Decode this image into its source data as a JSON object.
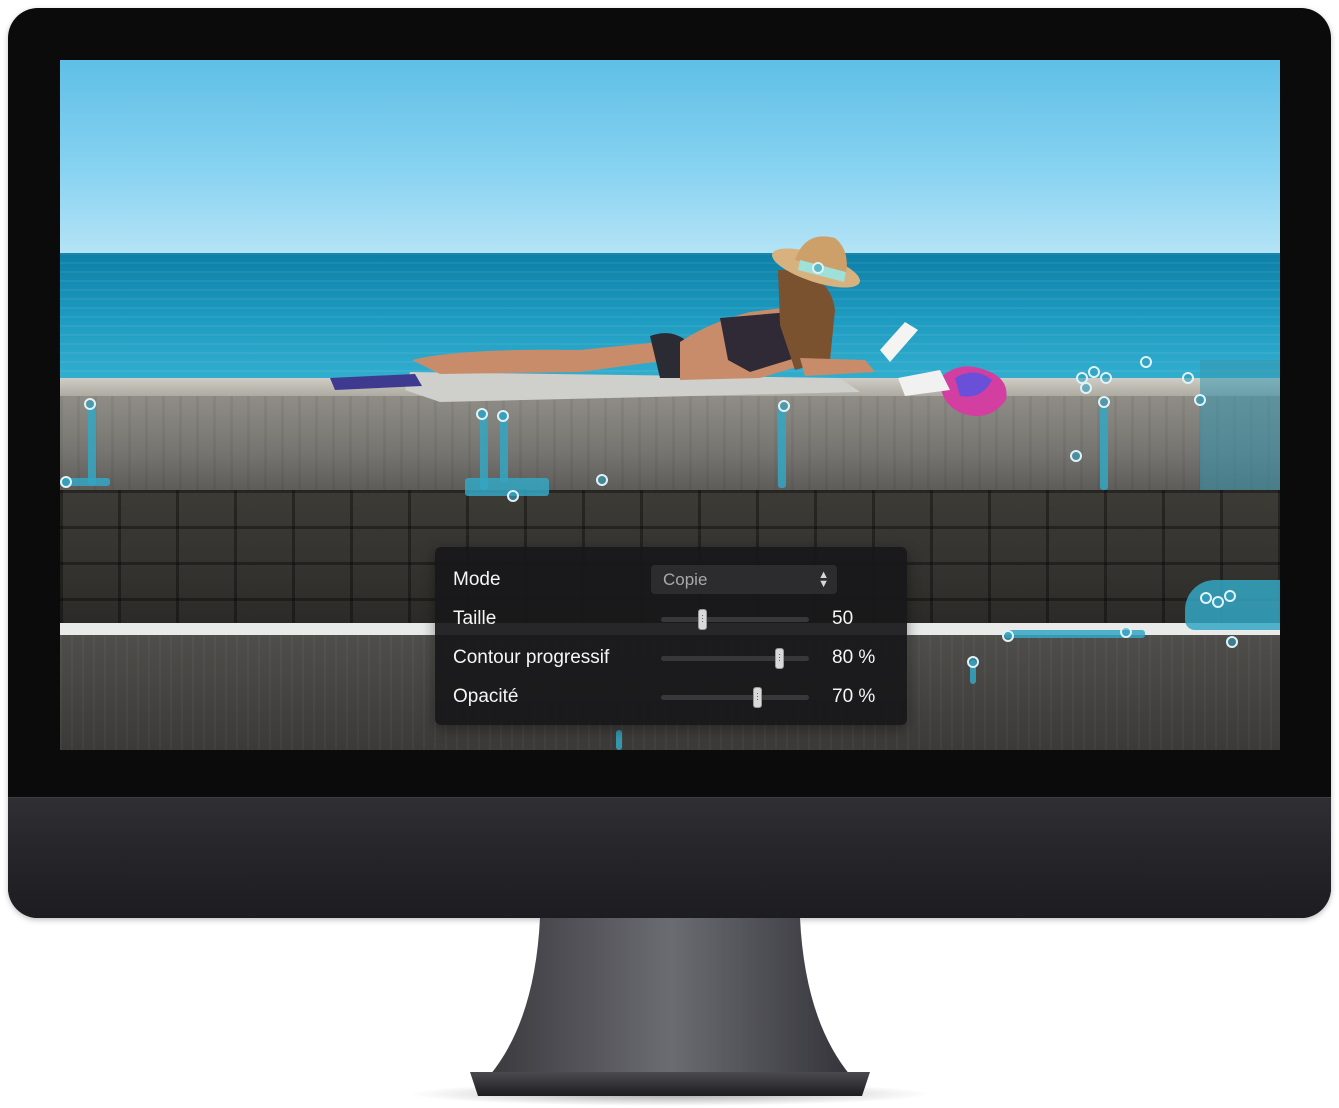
{
  "settings_panel": {
    "mode": {
      "label": "Mode",
      "value": "Copie"
    },
    "size": {
      "label": "Taille",
      "value_text": "50",
      "level": 0.28
    },
    "feather": {
      "label": "Contour progressif",
      "value_text": "80 %",
      "level": 0.8
    },
    "opacity": {
      "label": "Opacité",
      "value_text": "70 %",
      "level": 0.65
    }
  },
  "colors": {
    "retouch_stroke": "#34a7c3",
    "panel_background": "#18181a",
    "monitor_body": "#0b0b0c"
  }
}
